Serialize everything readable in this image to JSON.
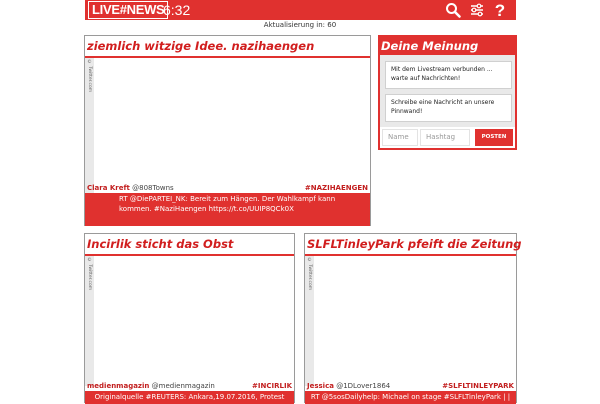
{
  "header": {
    "logo": "LIVE#NEWS",
    "time": "6:32",
    "icons": [
      "search-icon",
      "sliders-icon",
      "help-icon"
    ],
    "accent_color": "#e0312f"
  },
  "refresh": {
    "label": "Aktualisierung in:",
    "seconds": "60"
  },
  "cards": [
    {
      "title": "ziemlich witzige Idee. nazihaengen",
      "source_label": "© Twitter.com",
      "author": "Clara Kreft",
      "handle": "@808Towns",
      "hashtag": "#NAZIHAENGEN",
      "message": "RT @DiePARTEI_NK: Bereit zum Hängen. Der Wahlkampf kann kommen. #NaziHaengen https://t.co/UUIP8QCk0X"
    },
    {
      "title": "Incirlik sticht das Obst",
      "source_label": "© Twitter.com",
      "author": "medienmagazin",
      "handle": "@medienmagazin",
      "hashtag": "#INCIRLIK",
      "message": "Originalquelle #REUTERS: Ankara,19.07.2016, Protest"
    },
    {
      "title": "SLFLTinleyPark pfeift die Zeitung",
      "source_label": "© Twitter.com",
      "author": "Jessica",
      "handle": "@1DLover1864",
      "hashtag": "#SLFLTINLEYPARK",
      "message": "RT @5sosDailyhelp: Michael on stage #SLFLTinleyPark | |"
    }
  ],
  "opinion": {
    "title": "Deine Meinung",
    "status_message": "Mit dem Livestream verbunden ... warte auf Nachrichten!",
    "prompt_message": "Schreibe eine Nachricht an unsere Pinnwand!",
    "name_placeholder": "Name",
    "hashtag_placeholder": "Hashtag",
    "post_label": "POSTEN"
  }
}
